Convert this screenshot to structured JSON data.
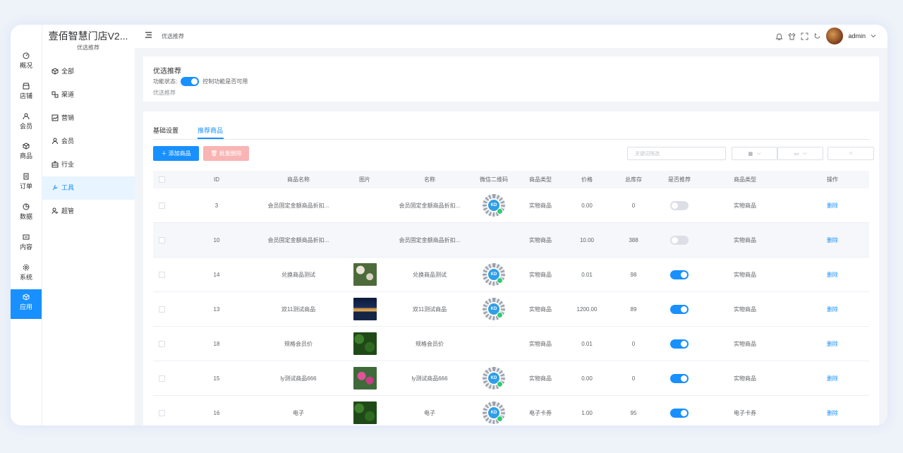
{
  "brand": {
    "name": "壹佰智慧门店V2...",
    "sub": "优选推荐"
  },
  "rail": [
    {
      "label": "概况",
      "icon": "dashboard-icon"
    },
    {
      "label": "店铺",
      "icon": "store-icon"
    },
    {
      "label": "会员",
      "icon": "user-icon"
    },
    {
      "label": "商品",
      "icon": "box-icon"
    },
    {
      "label": "订单",
      "icon": "order-icon"
    },
    {
      "label": "数据",
      "icon": "chart-icon"
    },
    {
      "label": "内容",
      "icon": "content-icon"
    },
    {
      "label": "系统",
      "icon": "gear-icon"
    },
    {
      "label": "应用",
      "icon": "app-icon",
      "active": true
    }
  ],
  "submenu": [
    {
      "label": "全部",
      "icon": "cube-icon"
    },
    {
      "label": "渠道",
      "icon": "channel-icon"
    },
    {
      "label": "营销",
      "icon": "marketing-icon"
    },
    {
      "label": "会员",
      "icon": "member-icon"
    },
    {
      "label": "行业",
      "icon": "industry-icon"
    },
    {
      "label": "工具",
      "icon": "tool-icon",
      "active": true
    },
    {
      "label": "超管",
      "icon": "admin-icon"
    }
  ],
  "topbar": {
    "breadcrumb": "优选推荐",
    "username": "admin"
  },
  "feature": {
    "title": "优选推荐",
    "status_label": "功能状态:",
    "status_hint": "控制功能是否可用",
    "desc": "优选推荐",
    "enabled": true
  },
  "tabs": [
    "基础设置",
    "推荐商品"
  ],
  "active_tab": 1,
  "actions": {
    "add": "添加商品",
    "batch_delete": "批量删除"
  },
  "search": {
    "placeholder": "关键词筛选"
  },
  "table": {
    "headers": [
      "ID",
      "商品名称",
      "图片",
      "名称",
      "微信二维码",
      "商品类型",
      "价格",
      "总库存",
      "是否推荐",
      "商品类型",
      "操作"
    ],
    "delete_label": "删除",
    "rows": [
      {
        "id": "3",
        "goods_name": "会员固定金额商品折扣...",
        "image": "",
        "name": "会员固定金额商品折扣...",
        "qr": true,
        "type": "实物商品",
        "price": "0.00",
        "stock": "0",
        "recommend": false,
        "type2": "实物商品"
      },
      {
        "id": "10",
        "goods_name": "会员固定金额商品折扣...",
        "image": "",
        "name": "会员固定金额商品折扣...",
        "qr": false,
        "type": "实物商品",
        "price": "10.00",
        "stock": "388",
        "recommend": false,
        "type2": "实物商品"
      },
      {
        "id": "14",
        "goods_name": "兑换商品测试",
        "image": "flowers",
        "name": "兑换商品测试",
        "qr": true,
        "type": "实物商品",
        "price": "0.01",
        "stock": "98",
        "recommend": true,
        "type2": "实物商品"
      },
      {
        "id": "13",
        "goods_name": "双11测试商品",
        "image": "building",
        "name": "双11测试商品",
        "qr": true,
        "type": "实物商品",
        "price": "1200.00",
        "stock": "89",
        "recommend": true,
        "type2": "实物商品"
      },
      {
        "id": "18",
        "goods_name": "规格会员价",
        "image": "leaves",
        "name": "规格会员价",
        "qr": false,
        "type": "实物商品",
        "price": "0.01",
        "stock": "0",
        "recommend": true,
        "type2": "实物商品"
      },
      {
        "id": "15",
        "goods_name": "ly测试商品666",
        "image": "pinkflowers",
        "name": "ly测试商品666",
        "qr": true,
        "type": "实物商品",
        "price": "0.00",
        "stock": "0",
        "recommend": true,
        "type2": "实物商品"
      },
      {
        "id": "16",
        "goods_name": "电子",
        "image": "leaves",
        "name": "电子",
        "qr": true,
        "type": "电子卡券",
        "price": "1.00",
        "stock": "95",
        "recommend": true,
        "type2": "电子卡券"
      }
    ]
  },
  "colors": {
    "primary": "#1890ff",
    "danger_light": "#f9b4b4",
    "switch_off": "#dcdfe6"
  }
}
